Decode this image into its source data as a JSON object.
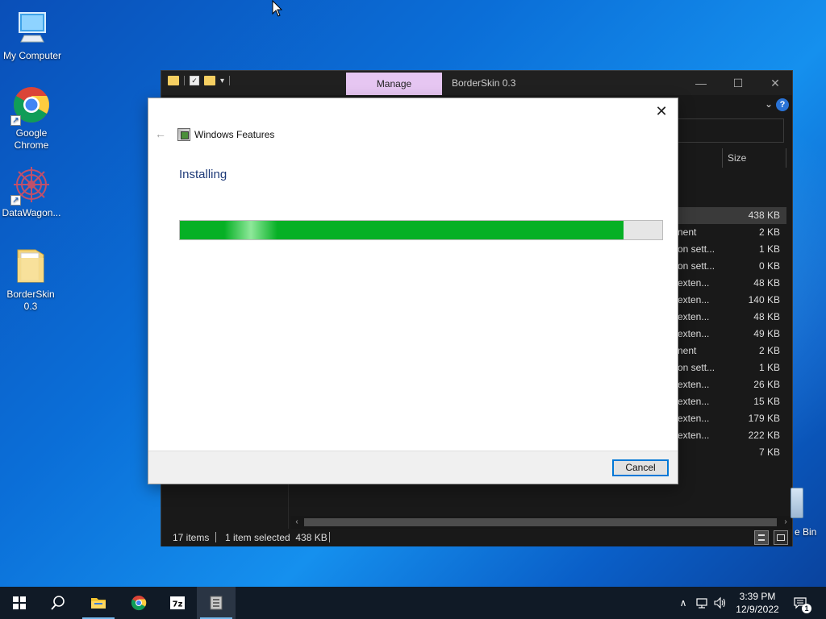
{
  "desktop": {
    "icons": [
      {
        "label": "My Computer"
      },
      {
        "label": "Google Chrome"
      },
      {
        "label": "DataWagon..."
      },
      {
        "label": "BorderSkin 0.3"
      }
    ],
    "recycle_label": "e Bin"
  },
  "explorer": {
    "manage_tab": "Manage",
    "title": "BorderSkin 0.3",
    "size_header": "Size",
    "rows": [
      {
        "type": "",
        "size": "438 KB",
        "selected": true
      },
      {
        "type": "nent",
        "size": "2 KB"
      },
      {
        "type": "on sett...",
        "size": "1 KB"
      },
      {
        "type": "on sett...",
        "size": "0 KB"
      },
      {
        "type": "exten...",
        "size": "48 KB"
      },
      {
        "type": "exten...",
        "size": "140 KB"
      },
      {
        "type": "exten...",
        "size": "48 KB"
      },
      {
        "type": "exten...",
        "size": "49 KB"
      },
      {
        "type": "nent",
        "size": "2 KB"
      },
      {
        "type": "on sett...",
        "size": "1 KB"
      },
      {
        "type": "exten...",
        "size": "26 KB"
      },
      {
        "type": "exten...",
        "size": "15 KB"
      },
      {
        "type": "exten...",
        "size": "179 KB"
      },
      {
        "type": "exten...",
        "size": "222 KB"
      },
      {
        "type": "",
        "size": "7 KB"
      }
    ],
    "status": {
      "items": "17 items",
      "selected": "1 item selected  438 KB"
    }
  },
  "dialog": {
    "app_title": "Windows Features",
    "heading": "Installing",
    "progress_fraction": 0.92,
    "cancel_label": "Cancel"
  },
  "taskbar": {
    "time": "3:39 PM",
    "date": "12/9/2022",
    "notification_count": "1",
    "apps": [
      "start",
      "search",
      "file-explorer",
      "chrome",
      "7zip",
      "windows-features"
    ]
  },
  "colors": {
    "progress_green": "#06b025",
    "manage_tab_bg": "#e6c6f2",
    "heading_blue": "#1e3a78",
    "taskbar_bg": "#101a26"
  }
}
